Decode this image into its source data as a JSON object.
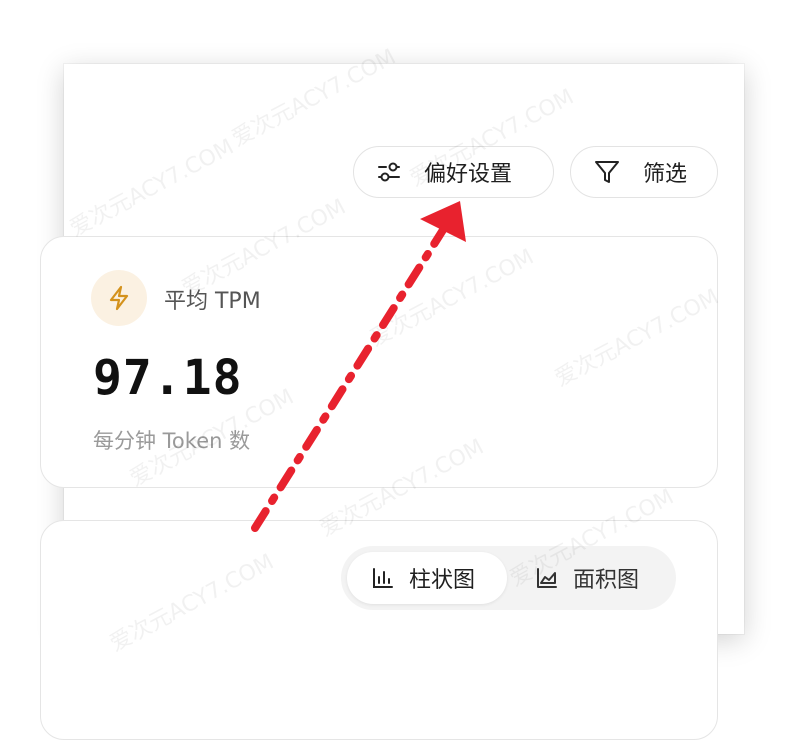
{
  "toolbar": {
    "preferences_label": "偏好设置",
    "filter_label": "筛选"
  },
  "tpm_card": {
    "label": "平均 TPM",
    "value": "97.18",
    "subtitle": "每分钟 Token 数",
    "icon": "lightning-icon",
    "accent": "#d4921c"
  },
  "chart_toggle": {
    "options": [
      {
        "label": "柱状图",
        "icon": "bar-chart-icon",
        "selected": true
      },
      {
        "label": "面积图",
        "icon": "area-chart-icon",
        "selected": false
      }
    ]
  },
  "annotation": {
    "color": "#e8222e"
  },
  "watermark_text": "爱次元ACY7.COM"
}
